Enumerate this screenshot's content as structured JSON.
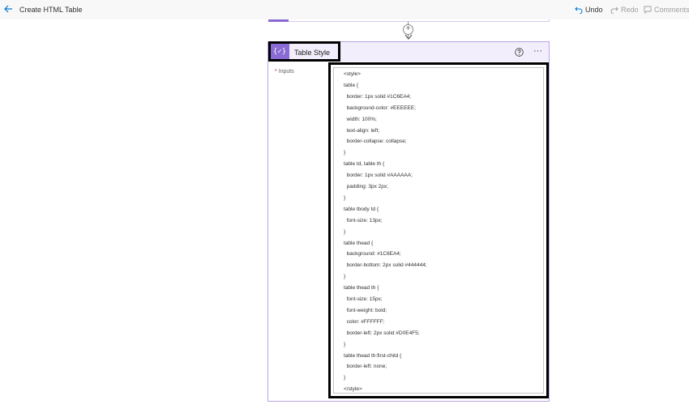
{
  "header": {
    "title": "Create HTML Table",
    "undo_label": "Undo",
    "redo_label": "Redo",
    "comments_label": "Comments"
  },
  "connector": {
    "plus_symbol": "+"
  },
  "action": {
    "icon_text": "{✓}",
    "title": "Table Style",
    "more_label": "···",
    "inputs_required_marker": "*",
    "inputs_label": "Inputs",
    "code_lines": [
      "<style>",
      "table {",
      "  border: 1px solid #1C6EA4;",
      "  background-color: #EEEEEE;",
      "  width: 100%;",
      "  text-align: left;",
      "  border-collapse: collapse;",
      "}",
      "table td, table th {",
      "  border: 1px solid #AAAAAA;",
      "  padding: 3px 2px;",
      "}",
      "table tbody td {",
      "  font-size: 13px;",
      "}",
      "table thead {",
      "  background: #1C6EA4;",
      "  border-bottom: 2px solid #444444;",
      "}",
      "table thead th {",
      "  font-size: 15px;",
      "  font-weight: bold;",
      "  color: #FFFFFF;",
      "  border-left: 2px solid #D0E4F5;",
      "}",
      "table thead th:first-child {",
      "  border-left: none;",
      "}",
      "</style>"
    ]
  },
  "colors": {
    "accent": "#8a6ad4",
    "card_header_bg": "#f2eefb",
    "card_border": "#b8a6e6",
    "highlight_box": "#000000"
  }
}
